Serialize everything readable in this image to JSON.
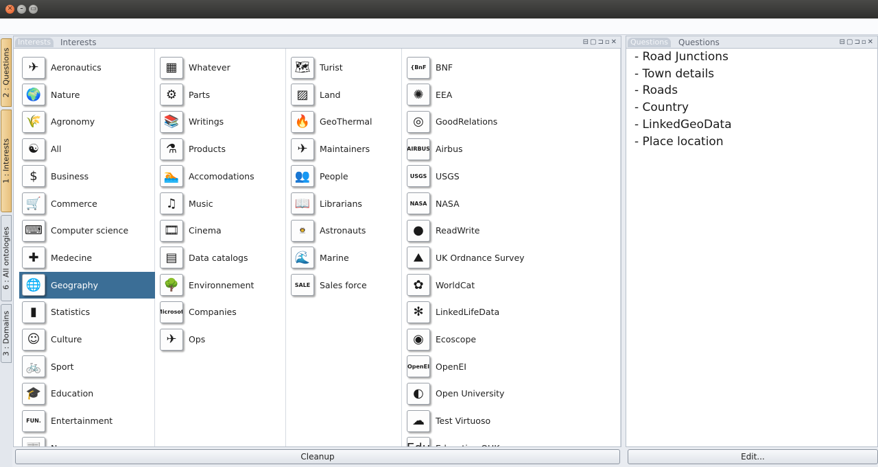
{
  "window": {
    "close_glyph": "✕",
    "minimize_glyph": "–",
    "maximize_glyph": "▭"
  },
  "side_tabs": [
    {
      "label": "2 : Questions",
      "active": true
    },
    {
      "label": "1 : Interests",
      "active": true
    },
    {
      "label": "6 : All ontologies",
      "active": false
    },
    {
      "label": "3 : Domains",
      "active": false
    }
  ],
  "interests_panel": {
    "tab_label": "Interests",
    "title": "Interests",
    "controls": "⊟▢⊐▫✕",
    "cleanup_button": "Cleanup",
    "columns": [
      {
        "items": [
          {
            "label": "Aeronautics",
            "icon": "airplane-icon",
            "glyph": "✈"
          },
          {
            "label": "Nature",
            "icon": "earth-icon",
            "glyph": "🌍"
          },
          {
            "label": "Agronomy",
            "icon": "field-icon",
            "glyph": "🌾"
          },
          {
            "label": "All",
            "icon": "yin-yang-icon",
            "glyph": "☯"
          },
          {
            "label": "Business",
            "icon": "dollar-icon",
            "glyph": "$"
          },
          {
            "label": "Commerce",
            "icon": "shopping-cart-icon",
            "glyph": "🛒"
          },
          {
            "label": "Computer science",
            "icon": "computer-icon",
            "glyph": "⌨"
          },
          {
            "label": "Medecine",
            "icon": "syringe-icon",
            "glyph": "✚"
          },
          {
            "label": "Geography",
            "icon": "globe-icon",
            "glyph": "🌐",
            "selected": true
          },
          {
            "label": "Statistics",
            "icon": "bar-chart-icon",
            "glyph": "▮"
          },
          {
            "label": "Culture",
            "icon": "portrait-icon",
            "glyph": "☺"
          },
          {
            "label": "Sport",
            "icon": "bicycle-icon",
            "glyph": "🚲"
          },
          {
            "label": "Education",
            "icon": "graduation-cap-icon",
            "glyph": "🎓"
          },
          {
            "label": "Entertainment",
            "icon": "fun-logo-icon",
            "glyph": "FUN."
          },
          {
            "label": "News",
            "icon": "newspaper-icon",
            "glyph": "📰"
          }
        ]
      },
      {
        "items": [
          {
            "label": "Whatever",
            "icon": "pattern-icon",
            "glyph": "▦"
          },
          {
            "label": "Parts",
            "icon": "gears-icon",
            "glyph": "⚙"
          },
          {
            "label": "Writings",
            "icon": "books-icon",
            "glyph": "📚"
          },
          {
            "label": "Products",
            "icon": "bottles-icon",
            "glyph": "⚗"
          },
          {
            "label": "Accomodations",
            "icon": "pool-icon",
            "glyph": "🏊"
          },
          {
            "label": "Music",
            "icon": "music-notes-icon",
            "glyph": "♫"
          },
          {
            "label": "Cinema",
            "icon": "film-strip-icon",
            "glyph": "🎞"
          },
          {
            "label": "Data catalogs",
            "icon": "data-grid-icon",
            "glyph": "▤"
          },
          {
            "label": "Environnement",
            "icon": "tree-icon",
            "glyph": "🌳"
          },
          {
            "label": "Companies",
            "icon": "microsoft-logo-icon",
            "glyph": "Microsoft"
          },
          {
            "label": "Ops",
            "icon": "aircraft-icon",
            "glyph": "✈"
          }
        ]
      },
      {
        "items": [
          {
            "label": "Turist",
            "icon": "map-icon",
            "glyph": "🗺"
          },
          {
            "label": "Land",
            "icon": "sketch-map-icon",
            "glyph": "▨"
          },
          {
            "label": "GeoThermal",
            "icon": "fire-icon",
            "glyph": "🔥"
          },
          {
            "label": "Maintainers",
            "icon": "plane-icon",
            "glyph": "✈"
          },
          {
            "label": "People",
            "icon": "crowd-icon",
            "glyph": "👥"
          },
          {
            "label": "Librarians",
            "icon": "librarian-icon",
            "glyph": "📖"
          },
          {
            "label": "Astronauts",
            "icon": "astronaut-icon",
            "glyph": "👨‍🚀"
          },
          {
            "label": "Marine",
            "icon": "sea-icon",
            "glyph": "🌊"
          },
          {
            "label": "Sales force",
            "icon": "sale-tag-icon",
            "glyph": "SALE"
          }
        ]
      },
      {
        "items": [
          {
            "label": "BNF",
            "icon": "bnf-logo-icon",
            "glyph": "{BnF"
          },
          {
            "label": "EEA",
            "icon": "eea-logo-icon",
            "glyph": "✺"
          },
          {
            "label": "GoodRelations",
            "icon": "goodrelations-logo-icon",
            "glyph": "◎"
          },
          {
            "label": "Airbus",
            "icon": "airbus-logo-icon",
            "glyph": "AIRBUS"
          },
          {
            "label": "USGS",
            "icon": "usgs-logo-icon",
            "glyph": "USGS"
          },
          {
            "label": "NASA",
            "icon": "nasa-logo-icon",
            "glyph": "NASA"
          },
          {
            "label": "ReadWrite",
            "icon": "blue-orb-icon",
            "glyph": "●"
          },
          {
            "label": "UK Ordnance Survey",
            "icon": "uk-map-icon",
            "glyph": "⛰"
          },
          {
            "label": "WorldCat",
            "icon": "worldcat-logo-icon",
            "glyph": "✿"
          },
          {
            "label": "LinkedLifeData",
            "icon": "pinwheel-icon",
            "glyph": "✻"
          },
          {
            "label": "Ecoscope",
            "icon": "eye-logo-icon",
            "glyph": "◉"
          },
          {
            "label": "OpenEI",
            "icon": "openei-logo-icon",
            "glyph": "OpenEI"
          },
          {
            "label": "Open University",
            "icon": "open-university-logo-icon",
            "glyph": "◐"
          },
          {
            "label": "Test Virtuoso",
            "icon": "virtuoso-logo-icon",
            "glyph": "☁"
          },
          {
            "label": "Education OUK",
            "icon": "education-logo-icon",
            "glyph": "Edu"
          }
        ]
      }
    ]
  },
  "questions_panel": {
    "tab_label": "Questions",
    "title": "Questions",
    "controls": "⊟▢⊐▫✕",
    "edit_button": "Edit...",
    "items": [
      "- Road Junctions",
      "- Town details",
      "- Roads",
      "- Country",
      "- LinkedGeoData",
      "- Place location"
    ]
  },
  "colors": {
    "selection": "#3b6e96",
    "accent_tab": "#e8c07c"
  }
}
